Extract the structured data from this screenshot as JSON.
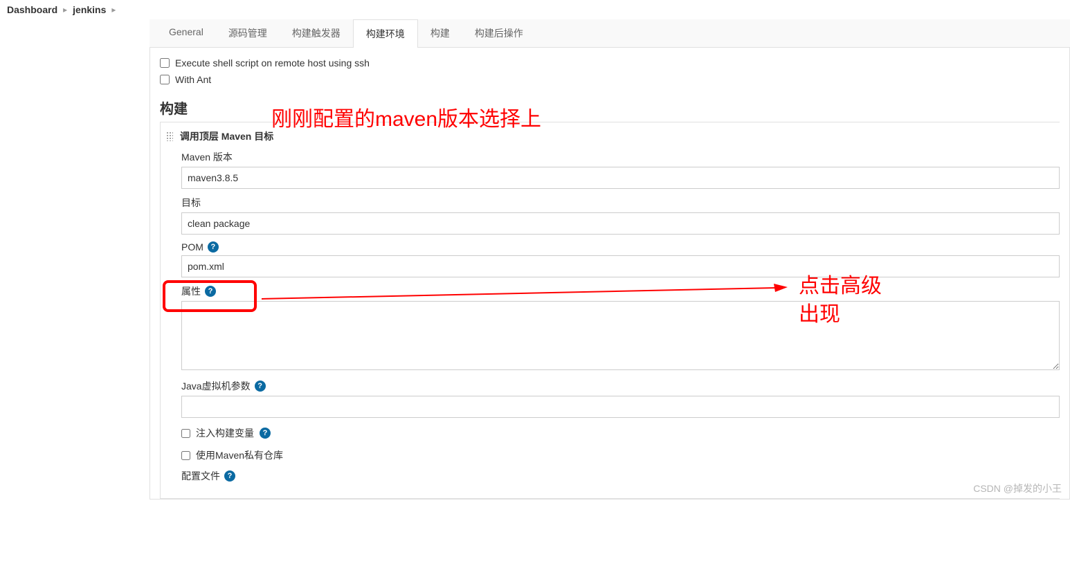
{
  "breadcrumb": {
    "items": [
      "Dashboard",
      "jenkins"
    ]
  },
  "tabs": {
    "items": [
      {
        "label": "General",
        "active": false
      },
      {
        "label": "源码管理",
        "active": false
      },
      {
        "label": "构建触发器",
        "active": false
      },
      {
        "label": "构建环境",
        "active": true
      },
      {
        "label": "构建",
        "active": false
      },
      {
        "label": "构建后操作",
        "active": false
      }
    ]
  },
  "buildEnv": {
    "executeShell": "Execute shell script on remote host using ssh",
    "withAnt": "With Ant"
  },
  "sectionTitle": "构建",
  "block": {
    "title": "调用顶层 Maven 目标",
    "mavenVersionLabel": "Maven 版本",
    "mavenVersionValue": "maven3.8.5",
    "targetLabel": "目标",
    "targetValue": "clean package",
    "pomLabel": "POM",
    "pomValue": "pom.xml",
    "propertiesLabel": "属性",
    "propertiesValue": "",
    "jvmLabel": "Java虚拟机参数",
    "jvmValue": "",
    "injectBuildVarsLabel": "注入构建变量",
    "usePrivateRepoLabel": "使用Maven私有仓库",
    "configFileLabel": "配置文件"
  },
  "annotations": {
    "topText": "刚刚配置的maven版本选择上",
    "rightText1": "点击高级",
    "rightText2": "出现"
  },
  "watermark": "CSDN @掉发的小王"
}
